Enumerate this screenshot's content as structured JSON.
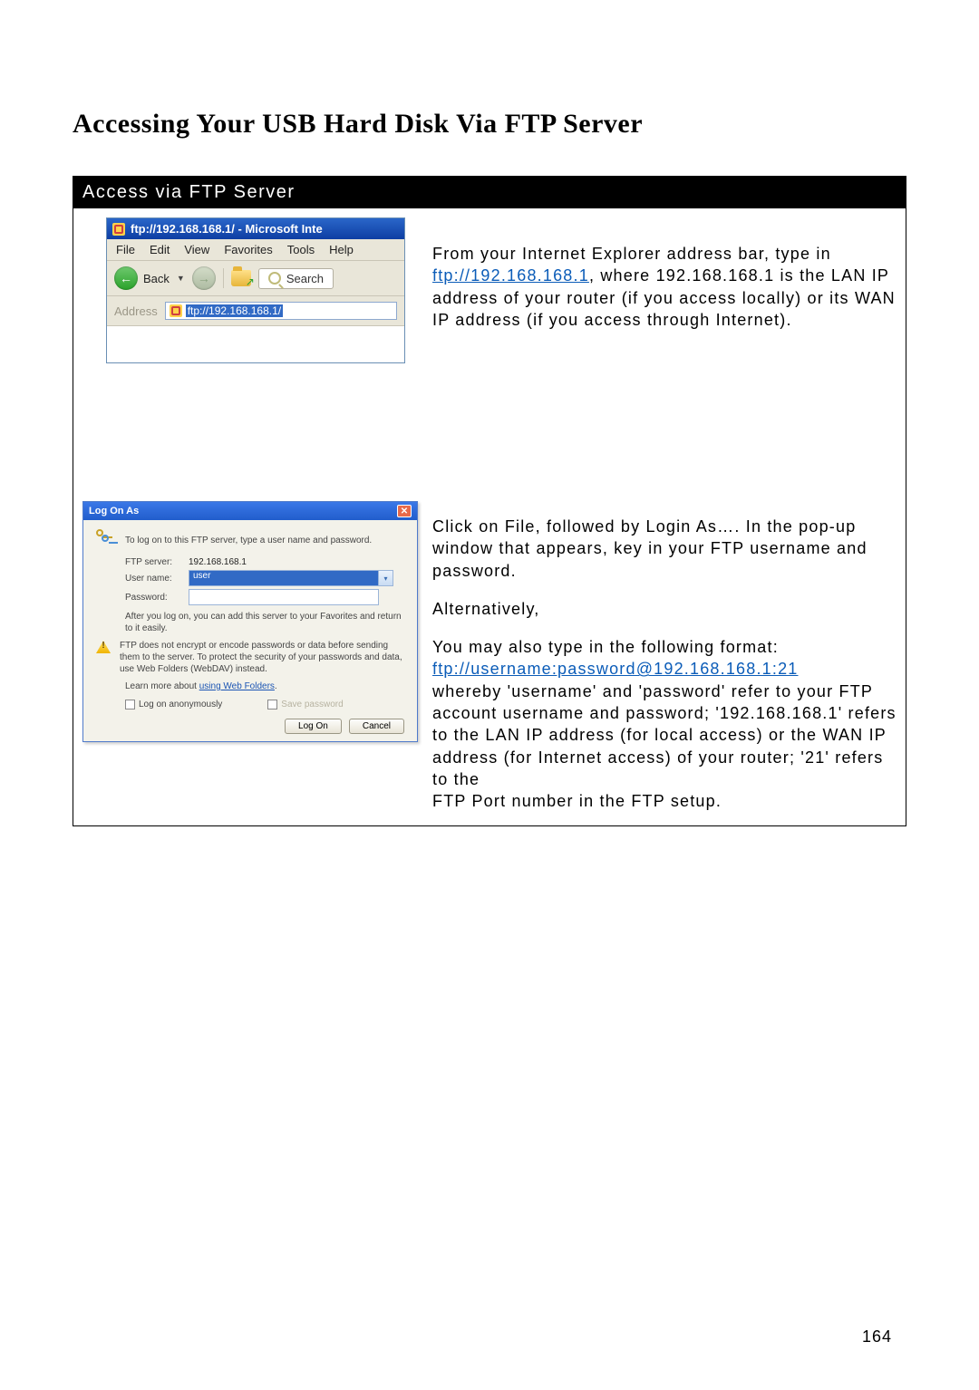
{
  "heading": "Accessing Your USB Hard Disk Via FTP Server",
  "section_title": "Access via FTP Server",
  "page_number": "164",
  "ie": {
    "title": "ftp://192.168.168.1/ - Microsoft Inte",
    "menu": {
      "file": "File",
      "edit": "Edit",
      "view": "View",
      "favorites": "Favorites",
      "tools": "Tools",
      "help": "Help"
    },
    "back_label": "Back",
    "search_label": "Search",
    "address_label": "Address",
    "address_value": "ftp://192.168.168.1/"
  },
  "instr1": {
    "pre": "From your Internet Explorer address bar, type in ",
    "link": "ftp://192.168.168.1",
    "post": ", where 192.168.168.1 is the LAN IP address of your router (if you access locally) or its WAN IP address (if you access through Internet)."
  },
  "logon": {
    "title": "Log On As",
    "intro": "To log on to this FTP server, type a user name and password.",
    "ftp_server_label": "FTP server:",
    "ftp_server_value": "192.168.168.1",
    "user_label": "User name:",
    "user_value": "user",
    "pass_label": "Password:",
    "after_text": "After you log on, you can add this server to your Favorites and return to it easily.",
    "warn_text": "FTP does not encrypt or encode passwords or data before sending them to the server.  To protect the security of your passwords and data, use Web Folders (WebDAV) instead.",
    "learn_prefix": "Learn more about ",
    "learn_link": "using Web Folders",
    "anon_label": "Log on anonymously",
    "save_label": "Save password",
    "logon_btn": "Log On",
    "cancel_btn": "Cancel"
  },
  "instr2": {
    "p1": "Click on File, followed by Login As…. In the pop-up window that appears, key in your FTP username and password.",
    "p2": "Alternatively,",
    "p3_pre": "You may also type in the following format: ",
    "p3_link": "ftp://username:password@192.168.168.1:21",
    "p3_post_a": "whereby 'username' and 'password' refer to your FTP account username and password; '192.168.168.1' refers to the LAN IP address (for local access) or the WAN IP address (for Internet access) of your router; '21' refers to the",
    "p3_post_b": "FTP Port number in the FTP setup."
  }
}
